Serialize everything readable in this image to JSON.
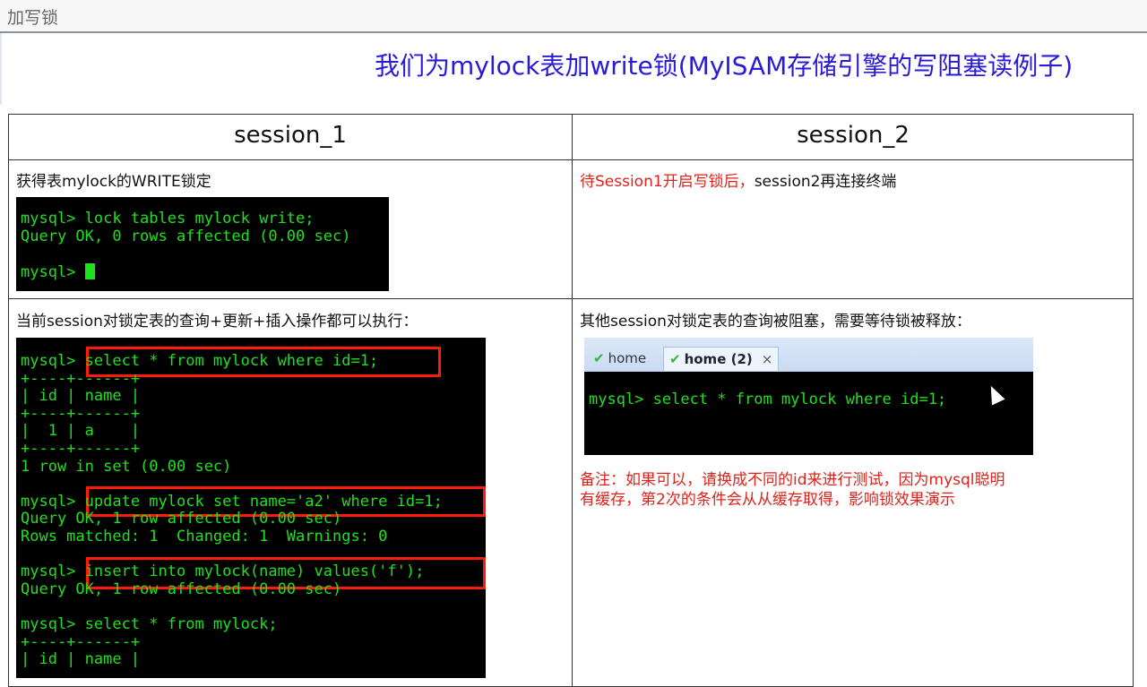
{
  "window_title": "加写锁",
  "heading": "我们为mylock表加write锁(MyISAM存储引擎的写阻塞读例子)",
  "table": {
    "headers": [
      "session_1",
      "session_2"
    ],
    "row1": {
      "left_text": "获得表mylock的WRITE锁定",
      "right_red": "待Session1开启写锁后，",
      "right_black": "session2再连接终端",
      "terminal": [
        "mysql> lock tables mylock write;",
        "Query OK, 0 rows affected (0.00 sec)",
        "",
        "mysql> "
      ]
    },
    "row2": {
      "left_text": "当前session对锁定表的查询+更新+插入操作都可以执行：",
      "right_text": "其他session对锁定表的查询被阻塞，需要等待锁被释放：",
      "terminal": [
        "mysql> select * from mylock where id=1;",
        "+----+------+",
        "| id | name |",
        "+----+------+",
        "|  1 | a    |",
        "+----+------+",
        "1 row in set (0.00 sec)",
        "",
        "mysql> update mylock set name='a2' where id=1;",
        "Query OK, 1 row affected (0.00 sec)",
        "Rows matched: 1  Changed: 1  Warnings: 0",
        "",
        "mysql> insert into mylock(name) values('f');",
        "Query OK, 1 row affected (0.00 sec)",
        "",
        "mysql> select * from mylock;",
        "+----+------+",
        "| id | name |"
      ],
      "inset": {
        "tabs": [
          "home",
          "home (2)"
        ],
        "close": "×",
        "terminal": "mysql> select * from mylock where id=1;"
      },
      "note": [
        "备注：如果可以，请换成不同的id来进行测试，因为mysql聪明",
        "有缓存，第2次的条件会从从缓存取得，影响锁效果演示"
      ]
    }
  },
  "colors": {
    "heading": "#2a1bd6",
    "terminal_text": "#1fe01f",
    "highlight_box": "#ff1a0a",
    "note": "#e0221a"
  }
}
